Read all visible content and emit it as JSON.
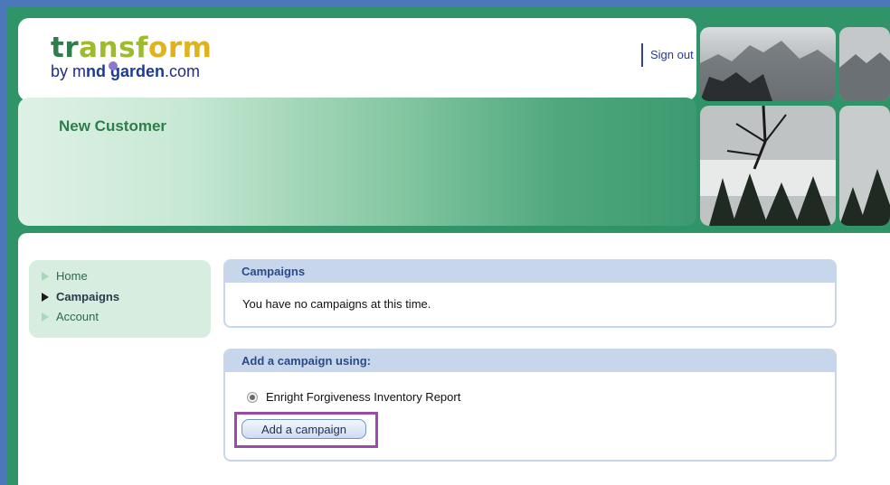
{
  "brand": {
    "logo_line1_a": "tr",
    "logo_line1_b": "ansf",
    "logo_line1_c": "orm",
    "logo_line2_prefix": "by m",
    "logo_line2_bold": "nd garden",
    "logo_line2_suffix": ".com"
  },
  "header": {
    "signout_label": "Sign out"
  },
  "banner": {
    "title": "New Customer"
  },
  "sidebar": {
    "items": [
      {
        "label": "Home",
        "active": false
      },
      {
        "label": "Campaigns",
        "active": true
      },
      {
        "label": "Account",
        "active": false
      }
    ]
  },
  "campaigns_panel": {
    "title": "Campaigns",
    "message": "You have no campaigns at this time."
  },
  "add_panel": {
    "title": "Add a campaign using:",
    "option_label": "Enright Forgiveness Inventory Report",
    "option_selected": true,
    "button_label": "Add a campaign"
  },
  "colors": {
    "frame": "#2f9468",
    "outer_bg": "#4a78b8",
    "title_green": "#2e7d4a",
    "panel_header": "#c8d6ec",
    "highlight": "#9a4aa8"
  }
}
